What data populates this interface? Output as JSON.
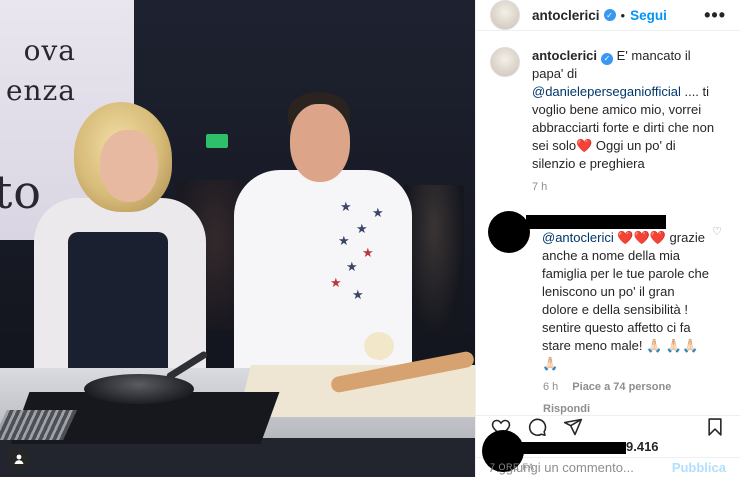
{
  "photo": {
    "banner_lines": [
      "ova",
      "enza",
      "to"
    ]
  },
  "header": {
    "username": "antoclerici",
    "separator": "•",
    "follow_label": "Segui",
    "more_label": "•••"
  },
  "caption": {
    "username": "antoclerici",
    "text_part1": "E' mancato il papa' di",
    "mention": "@danieleperseganiofficial",
    "text_part2": ".... ti voglio bene amico mio, vorrei abbracciarti forte e dirti che non sei solo",
    "heart": "❤️",
    "text_part3": " Oggi un po' di silenzio e preghiera",
    "time": "7 h"
  },
  "comment": {
    "mention": "@antoclerici",
    "hearts": "❤️❤️❤️",
    "text": "grazie anche a nome della mia famiglia per le tue parole che leniscono un po' il gran dolore e della sensibilità ! sentire questo affetto ci fa stare meno male! 🙏🏻 🙏🏻🙏🏻🙏🏻",
    "time": "6 h",
    "likes": "Piace a 74 persone",
    "reply_label": "Rispondi"
  },
  "likes": {
    "count": "9.416",
    "time_ago": "7 ORE FA"
  },
  "add_comment": {
    "placeholder": "Aggiungi un commento...",
    "publish_label": "Pubblica"
  },
  "colors": {
    "accent": "#0095f6",
    "verified": "#3897f0",
    "publish_disabled": "#b2dffc"
  }
}
